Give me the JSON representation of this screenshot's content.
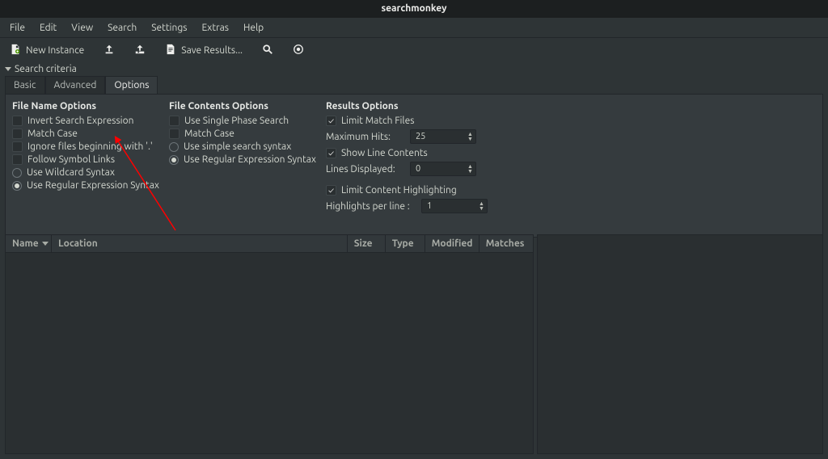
{
  "window": {
    "title": "searchmonkey"
  },
  "menu": {
    "file": "File",
    "edit": "Edit",
    "view": "View",
    "search": "Search",
    "settings": "Settings",
    "extras": "Extras",
    "help": "Help"
  },
  "toolbar": {
    "new_instance": "New Instance",
    "save_results": "Save Results..."
  },
  "section": {
    "criteria": "Search criteria"
  },
  "tabs": {
    "basic": "Basic",
    "advanced": "Advanced",
    "options": "Options"
  },
  "groups": {
    "file_name": {
      "title": "File Name Options",
      "invert": "Invert Search Expression",
      "match_case": "Match Case",
      "ignore_dot": "Ignore files beginning with '.'",
      "follow_symlinks": "Follow Symbol Links",
      "wildcard": "Use Wildcard Syntax",
      "regex": "Use Regular Expression Syntax"
    },
    "file_contents": {
      "title": "File Contents Options",
      "single_phase": "Use Single Phase Search",
      "match_case": "Match Case",
      "simple": "Use simple search syntax",
      "regex": "Use Regular Expression Syntax"
    },
    "results": {
      "title": "Results Options",
      "limit_match": "Limit Match Files",
      "max_hits_label": "Maximum Hits:",
      "max_hits_value": "25",
      "show_line": "Show Line Contents",
      "lines_disp_label": "Lines Displayed:",
      "lines_disp_value": "0",
      "limit_highlight": "Limit Content Highlighting",
      "hl_per_line_label": "Highlights per line :",
      "hl_per_line_value": "1"
    }
  },
  "columns": {
    "name": "Name",
    "location": "Location",
    "size": "Size",
    "type": "Type",
    "modified": "Modified",
    "matches": "Matches"
  }
}
